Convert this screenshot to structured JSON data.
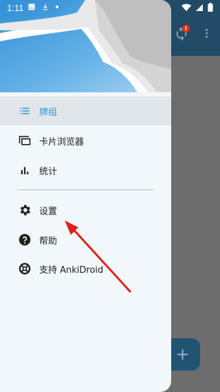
{
  "status_bar": {
    "time": "1:11"
  },
  "background_app": {
    "sync_badge": "!",
    "fab_label": "+"
  },
  "drawer": {
    "items": [
      {
        "label": "牌组",
        "icon": "list-icon",
        "active": true
      },
      {
        "label": "卡片浏览器",
        "icon": "card-browser-icon",
        "active": false
      },
      {
        "label": "统计",
        "icon": "bar-chart-icon",
        "active": false
      },
      {
        "label": "设置",
        "icon": "gear-icon",
        "active": false
      },
      {
        "label": "帮助",
        "icon": "help-icon",
        "active": false
      },
      {
        "label": "支持 AnkiDroid",
        "icon": "lifebuoy-icon",
        "active": false
      }
    ]
  },
  "colors": {
    "accent": "#2f97d8",
    "toolbar": "#214b66",
    "annotation_arrow": "#e0211a"
  }
}
